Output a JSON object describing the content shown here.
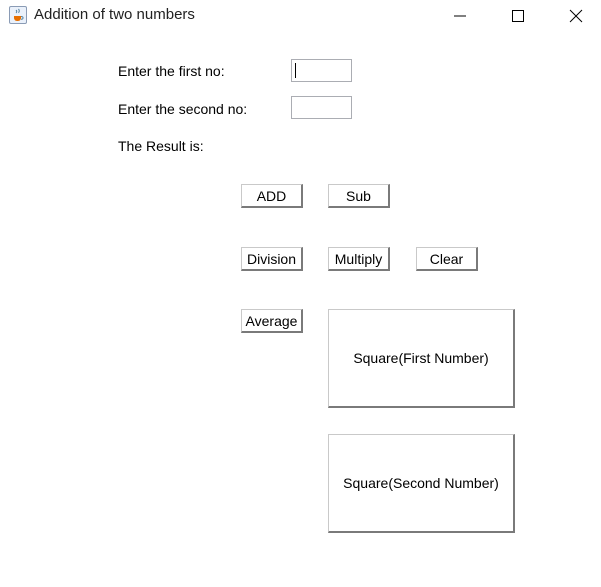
{
  "window": {
    "title": "Addition of two numbers",
    "app_icon": "java-cup-icon",
    "controls": {
      "minimize": "minimize-icon",
      "maximize": "maximize-icon",
      "close": "close-icon"
    }
  },
  "form": {
    "first_label": "Enter the first no:",
    "second_label": "Enter the second no:",
    "result_label": "The Result is:",
    "first_value": "",
    "second_value": ""
  },
  "buttons": {
    "add": "ADD",
    "sub": "Sub",
    "division": "Division",
    "multiply": "Multiply",
    "clear": "Clear",
    "average": "Average",
    "square_first": "Square(First Number)",
    "square_second": "Square(Second Number)"
  }
}
